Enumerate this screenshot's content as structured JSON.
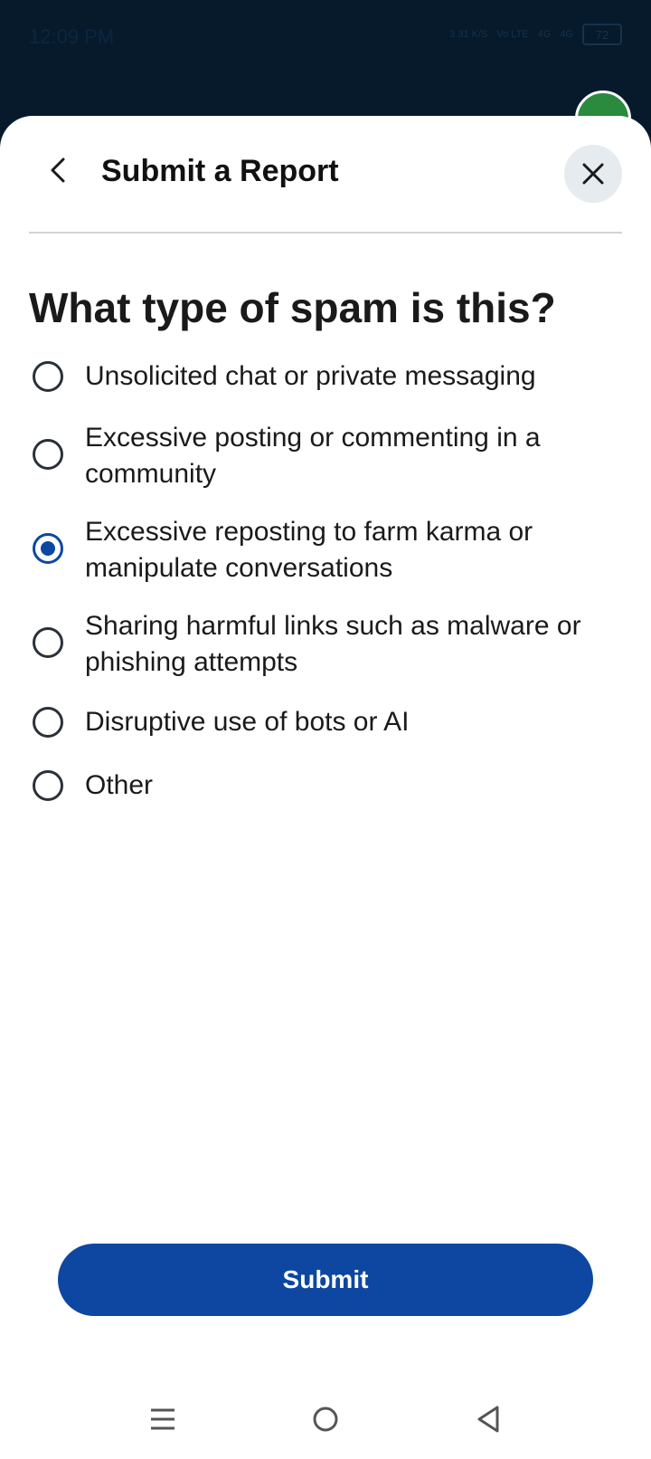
{
  "status_bar": {
    "time": "12:09 PM",
    "net_speed": "3.31 K/S",
    "volte": "Vo LTE",
    "signal_1": "4G",
    "signal_2": "4G",
    "battery": "72"
  },
  "sheet": {
    "title": "Submit a Report",
    "question": "What type of spam is this?",
    "options": [
      {
        "label": "Unsolicited chat or private messaging",
        "selected": false
      },
      {
        "label": "Excessive posting or commenting in a community",
        "selected": false
      },
      {
        "label": "Excessive reposting to farm karma or manipulate conversations",
        "selected": true
      },
      {
        "label": "Sharing harmful links such as malware or phishing attempts",
        "selected": false
      },
      {
        "label": "Disruptive use of bots or AI",
        "selected": false
      },
      {
        "label": "Other",
        "selected": false
      }
    ],
    "submit_label": "Submit"
  },
  "icons": {
    "back": "chevron-left-icon",
    "close": "close-icon",
    "nav_menu": "menu-icon",
    "nav_home": "home-circle-icon",
    "nav_back": "triangle-back-icon"
  },
  "colors": {
    "accent": "#0d47a1",
    "backdrop": "#061a2c",
    "close_bg": "#e6ebef"
  }
}
